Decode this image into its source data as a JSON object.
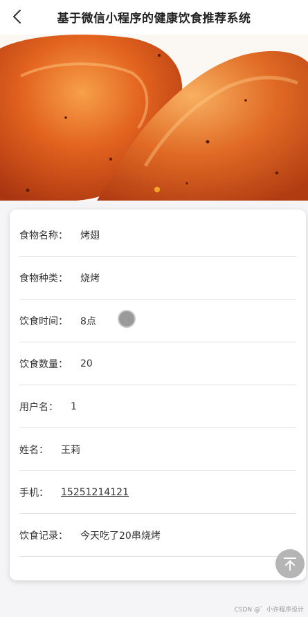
{
  "header": {
    "title": "基于微信小程序的健康饮食推荐系统",
    "back_icon": "chevron-left-icon"
  },
  "carousel": {
    "image": "roasted-chicken-wings",
    "slide_count": 1,
    "active_index": 0,
    "indicator_color": "#f5a623"
  },
  "detail": {
    "fields": [
      {
        "label": "食物名称：",
        "value": "烤翅"
      },
      {
        "label": "食物种类：",
        "value": "烧烤"
      },
      {
        "label": "饮食时间：",
        "value": "8点"
      },
      {
        "label": "饮食数量：",
        "value": "20"
      },
      {
        "label": "用户名：",
        "value": "1"
      },
      {
        "label": "姓名：",
        "value": "王莉"
      },
      {
        "label": "手机：",
        "value": "15251214121"
      },
      {
        "label": "饮食记录：",
        "value": "今天吃了20串烧烤"
      }
    ]
  },
  "back_to_top": {
    "icon": "arrow-up-to-top-icon"
  },
  "watermark": "CSDN @゛小许程序设计"
}
